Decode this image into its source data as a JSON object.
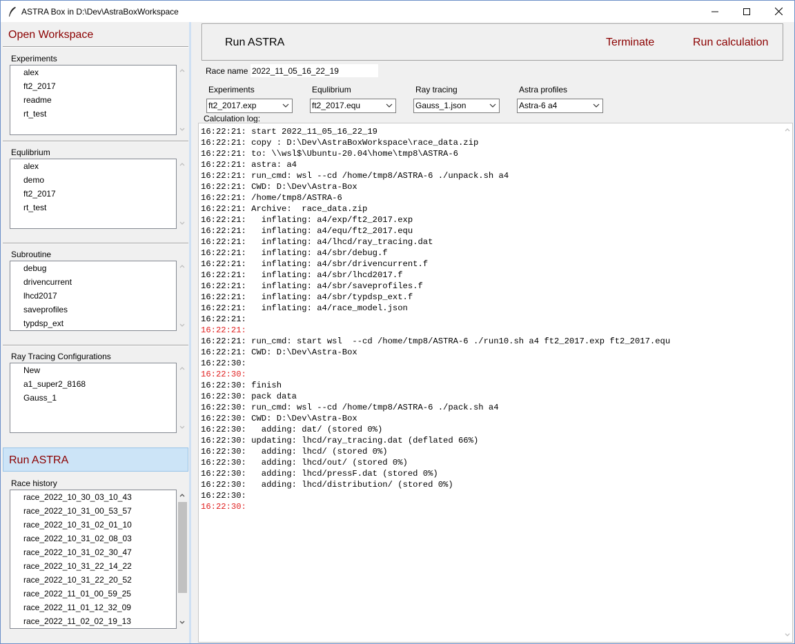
{
  "window": {
    "title": "ASTRA Box in D:\\Dev\\AstraBoxWorkspace"
  },
  "sidebar": {
    "open_workspace": "Open Workspace",
    "experiments": {
      "label": "Experiments",
      "items": [
        "alex",
        "ft2_2017",
        "readme",
        "rt_test"
      ]
    },
    "equilibrium": {
      "label": "Equlibrium",
      "items": [
        "alex",
        "demo",
        "ft2_2017",
        "rt_test"
      ]
    },
    "subroutine": {
      "label": "Subroutine",
      "items": [
        "debug",
        "drivencurrent",
        "lhcd2017",
        "saveprofiles",
        "typdsp_ext"
      ]
    },
    "ray_tracing": {
      "label": "Ray Tracing Configurations",
      "items": [
        "New",
        "a1_super2_8168",
        "Gauss_1"
      ]
    },
    "run_astra": "Run ASTRA",
    "race_history": {
      "label": "Race history",
      "items": [
        "race_2022_10_30_03_10_43",
        "race_2022_10_31_00_53_57",
        "race_2022_10_31_02_01_10",
        "race_2022_10_31_02_08_03",
        "race_2022_10_31_02_30_47",
        "race_2022_10_31_22_14_22",
        "race_2022_10_31_22_20_52",
        "race_2022_11_01_00_59_25",
        "race_2022_11_01_12_32_09",
        "race_2022_11_02_02_19_13"
      ]
    }
  },
  "main": {
    "title": "Run ASTRA",
    "terminate_label": "Terminate",
    "run_label": "Run calculation",
    "race_name_label": "Race name",
    "race_name_value": "2022_11_05_16_22_19",
    "selectors": {
      "experiments": {
        "label": "Experiments",
        "value": "ft2_2017.exp"
      },
      "equilibrium": {
        "label": "Equlibrium",
        "value": "ft2_2017.equ"
      },
      "ray_tracing": {
        "label": "Ray tracing",
        "value": "Gauss_1.json"
      },
      "astra_profiles": {
        "label": "Astra profiles",
        "value": "Astra-6 a4"
      }
    },
    "log_label": "Calculation log:",
    "log": [
      {
        "text": "16:22:21: start 2022_11_05_16_22_19",
        "err": false
      },
      {
        "text": "16:22:21: copy : D:\\Dev\\AstraBoxWorkspace\\race_data.zip",
        "err": false
      },
      {
        "text": "16:22:21: to: \\\\wsl$\\Ubuntu-20.04\\home\\tmp8\\ASTRA-6",
        "err": false
      },
      {
        "text": "16:22:21: astra: a4",
        "err": false
      },
      {
        "text": "16:22:21: run_cmd: wsl --cd /home/tmp8/ASTRA-6 ./unpack.sh a4",
        "err": false
      },
      {
        "text": "16:22:21: CWD: D:\\Dev\\Astra-Box",
        "err": false
      },
      {
        "text": "16:22:21: /home/tmp8/ASTRA-6",
        "err": false
      },
      {
        "text": "16:22:21: Archive:  race_data.zip",
        "err": false
      },
      {
        "text": "16:22:21:   inflating: a4/exp/ft2_2017.exp",
        "err": false
      },
      {
        "text": "16:22:21:   inflating: a4/equ/ft2_2017.equ",
        "err": false
      },
      {
        "text": "16:22:21:   inflating: a4/lhcd/ray_tracing.dat",
        "err": false
      },
      {
        "text": "16:22:21:   inflating: a4/sbr/debug.f",
        "err": false
      },
      {
        "text": "16:22:21:   inflating: a4/sbr/drivencurrent.f",
        "err": false
      },
      {
        "text": "16:22:21:   inflating: a4/sbr/lhcd2017.f",
        "err": false
      },
      {
        "text": "16:22:21:   inflating: a4/sbr/saveprofiles.f",
        "err": false
      },
      {
        "text": "16:22:21:   inflating: a4/sbr/typdsp_ext.f",
        "err": false
      },
      {
        "text": "16:22:21:   inflating: a4/race_model.json",
        "err": false
      },
      {
        "text": "16:22:21:",
        "err": false
      },
      {
        "text": "16:22:21:",
        "err": true
      },
      {
        "text": "16:22:21: run_cmd: start wsl  --cd /home/tmp8/ASTRA-6 ./run10.sh a4 ft2_2017.exp ft2_2017.equ",
        "err": false
      },
      {
        "text": "16:22:21: CWD: D:\\Dev\\Astra-Box",
        "err": false
      },
      {
        "text": "16:22:30:",
        "err": false
      },
      {
        "text": "16:22:30:",
        "err": true
      },
      {
        "text": "16:22:30: finish",
        "err": false
      },
      {
        "text": "16:22:30: pack data",
        "err": false
      },
      {
        "text": "16:22:30: run_cmd: wsl --cd /home/tmp8/ASTRA-6 ./pack.sh a4",
        "err": false
      },
      {
        "text": "16:22:30: CWD: D:\\Dev\\Astra-Box",
        "err": false
      },
      {
        "text": "16:22:30:   adding: dat/ (stored 0%)",
        "err": false
      },
      {
        "text": "16:22:30: updating: lhcd/ray_tracing.dat (deflated 66%)",
        "err": false
      },
      {
        "text": "16:22:30:   adding: lhcd/ (stored 0%)",
        "err": false
      },
      {
        "text": "16:22:30:   adding: lhcd/out/ (stored 0%)",
        "err": false
      },
      {
        "text": "16:22:30:   adding: lhcd/pressF.dat (stored 0%)",
        "err": false
      },
      {
        "text": "16:22:30:   adding: lhcd/distribution/ (stored 0%)",
        "err": false
      },
      {
        "text": "16:22:30:",
        "err": false
      },
      {
        "text": "16:22:30:",
        "err": true
      }
    ]
  },
  "icons": {
    "app": "feather-icon",
    "minimize": "minimize-icon",
    "maximize": "maximize-icon",
    "close": "close-icon"
  },
  "colors": {
    "accent_text": "#8b0000",
    "error_text": "#e02020",
    "selected_panel": "#cce4f7"
  }
}
